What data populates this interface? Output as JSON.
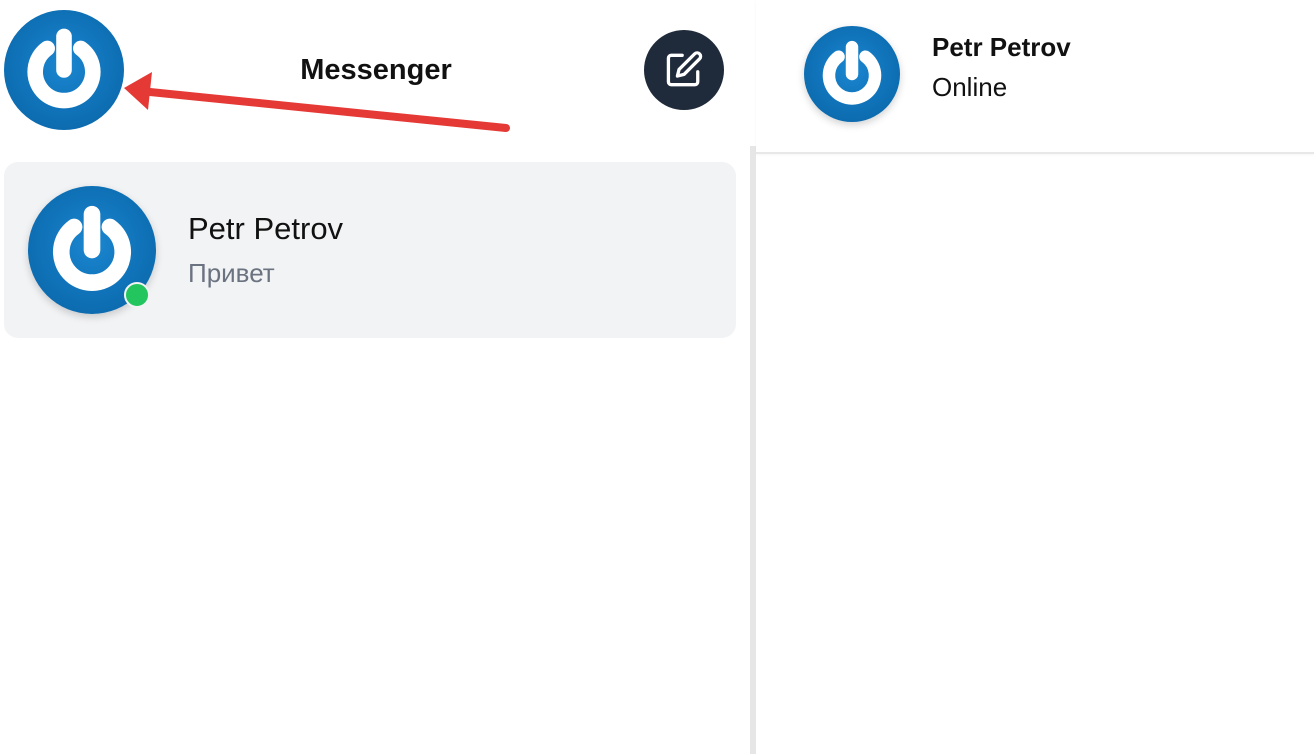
{
  "header": {
    "title": "Messenger",
    "self_avatar_icon": "power-logo-avatar",
    "compose_icon": "edit-square-icon"
  },
  "conversations": [
    {
      "name": "Petr Petrov",
      "preview": "Привет",
      "avatar_icon": "power-logo-avatar",
      "online": true
    }
  ],
  "chat": {
    "contact_name": "Petr Petrov",
    "status": "Online",
    "avatar_icon": "power-logo-avatar"
  },
  "colors": {
    "avatar_blue": "#0e6fb4",
    "compose_button_bg": "#1f2a3a",
    "online_dot": "#22c55e",
    "conversation_bg": "#f2f3f5",
    "annotation_arrow": "#e53935"
  }
}
